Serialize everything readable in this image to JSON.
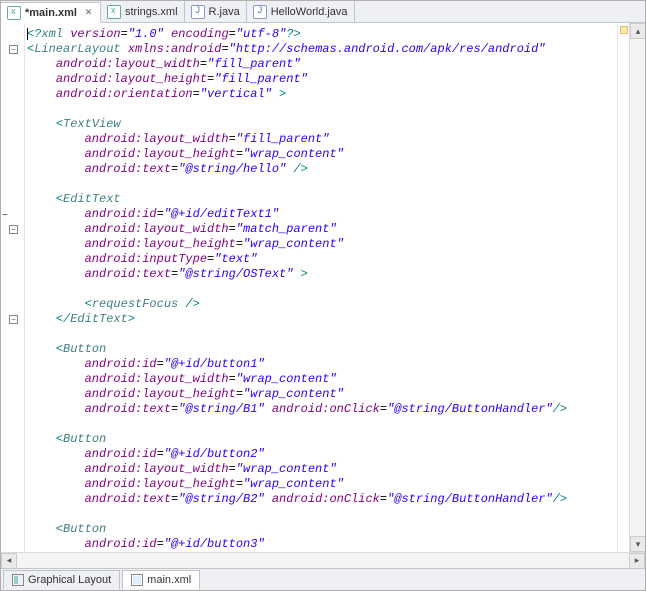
{
  "tabs": [
    {
      "label": "*main.xml",
      "icon": "xml",
      "active": true,
      "dirty": true,
      "closeable": true
    },
    {
      "label": "strings.xml",
      "icon": "xml",
      "active": false
    },
    {
      "label": "R.java",
      "icon": "java",
      "active": false
    },
    {
      "label": "HelloWorld.java",
      "icon": "java",
      "active": false
    }
  ],
  "bottom_tabs": [
    {
      "label": "Graphical Layout",
      "icon": "layout",
      "active": false
    },
    {
      "label": "main.xml",
      "icon": "file",
      "active": true
    }
  ],
  "fold_marks": [
    {
      "line": 1,
      "glyph": "−"
    },
    {
      "line": 14,
      "glyph": "−"
    },
    {
      "line": 20,
      "glyph": "−"
    }
  ],
  "collapse_bar": {
    "line": 13,
    "glyph": "−"
  },
  "code_lines": [
    {
      "cursor": true,
      "tokens": [
        {
          "t": "<?",
          "c": "punc"
        },
        {
          "t": "xml",
          "c": "tag"
        },
        {
          "t": " version",
          "c": "attr"
        },
        {
          "t": "=",
          "c": "plain"
        },
        {
          "t": "\"1.0\"",
          "c": "str"
        },
        {
          "t": " encoding",
          "c": "attr"
        },
        {
          "t": "=",
          "c": "plain"
        },
        {
          "t": "\"utf-8\"",
          "c": "str"
        },
        {
          "t": "?>",
          "c": "punc"
        }
      ]
    },
    {
      "indent": 0,
      "tokens": [
        {
          "t": "<",
          "c": "punc"
        },
        {
          "t": "LinearLayout",
          "c": "tag"
        },
        {
          "t": " xmlns:android",
          "c": "attr"
        },
        {
          "t": "=",
          "c": "plain"
        },
        {
          "t": "\"http://schemas.android.com/apk/res/android\"",
          "c": "str"
        }
      ]
    },
    {
      "indent": 1,
      "tokens": [
        {
          "t": "android:layout_width",
          "c": "attr"
        },
        {
          "t": "=",
          "c": "plain"
        },
        {
          "t": "\"fill_parent\"",
          "c": "str"
        }
      ]
    },
    {
      "indent": 1,
      "tokens": [
        {
          "t": "android:layout_height",
          "c": "attr"
        },
        {
          "t": "=",
          "c": "plain"
        },
        {
          "t": "\"fill_parent\"",
          "c": "str"
        }
      ]
    },
    {
      "indent": 1,
      "tokens": [
        {
          "t": "android:orientation",
          "c": "attr"
        },
        {
          "t": "=",
          "c": "plain"
        },
        {
          "t": "\"vertical\"",
          "c": "str"
        },
        {
          "t": " >",
          "c": "punc"
        }
      ]
    },
    {
      "blank": true
    },
    {
      "indent": 1,
      "tokens": [
        {
          "t": "<",
          "c": "punc"
        },
        {
          "t": "TextView",
          "c": "tag"
        }
      ]
    },
    {
      "indent": 2,
      "tokens": [
        {
          "t": "android:layout_width",
          "c": "attr"
        },
        {
          "t": "=",
          "c": "plain"
        },
        {
          "t": "\"fill_parent\"",
          "c": "str"
        }
      ]
    },
    {
      "indent": 2,
      "tokens": [
        {
          "t": "android:layout_height",
          "c": "attr"
        },
        {
          "t": "=",
          "c": "plain"
        },
        {
          "t": "\"wrap_content\"",
          "c": "str"
        }
      ]
    },
    {
      "indent": 2,
      "tokens": [
        {
          "t": "android:text",
          "c": "attr"
        },
        {
          "t": "=",
          "c": "plain"
        },
        {
          "t": "\"@string/hello\"",
          "c": "str"
        },
        {
          "t": " />",
          "c": "punc"
        }
      ]
    },
    {
      "blank": true
    },
    {
      "indent": 1,
      "tokens": [
        {
          "t": "<",
          "c": "punc"
        },
        {
          "t": "EditText",
          "c": "tag"
        }
      ]
    },
    {
      "indent": 2,
      "tokens": [
        {
          "t": "android:id",
          "c": "attr"
        },
        {
          "t": "=",
          "c": "plain"
        },
        {
          "t": "\"@+id/editText1\"",
          "c": "str"
        }
      ]
    },
    {
      "indent": 2,
      "tokens": [
        {
          "t": "android:layout_width",
          "c": "attr"
        },
        {
          "t": "=",
          "c": "plain"
        },
        {
          "t": "\"match_parent\"",
          "c": "str"
        }
      ]
    },
    {
      "indent": 2,
      "tokens": [
        {
          "t": "android:layout_height",
          "c": "attr"
        },
        {
          "t": "=",
          "c": "plain"
        },
        {
          "t": "\"wrap_content\"",
          "c": "str"
        }
      ]
    },
    {
      "indent": 2,
      "tokens": [
        {
          "t": "android:inputType",
          "c": "attr"
        },
        {
          "t": "=",
          "c": "plain"
        },
        {
          "t": "\"text\"",
          "c": "str"
        }
      ]
    },
    {
      "indent": 2,
      "tokens": [
        {
          "t": "android:text",
          "c": "attr"
        },
        {
          "t": "=",
          "c": "plain"
        },
        {
          "t": "\"@string/OSText\"",
          "c": "str"
        },
        {
          "t": " >",
          "c": "punc"
        }
      ]
    },
    {
      "blank": true
    },
    {
      "indent": 2,
      "tokens": [
        {
          "t": "<",
          "c": "punc"
        },
        {
          "t": "requestFocus",
          "c": "tag"
        },
        {
          "t": " />",
          "c": "punc"
        }
      ]
    },
    {
      "indent": 1,
      "tokens": [
        {
          "t": "</",
          "c": "punc"
        },
        {
          "t": "EditText",
          "c": "tag"
        },
        {
          "t": ">",
          "c": "punc"
        }
      ]
    },
    {
      "blank": true
    },
    {
      "indent": 1,
      "tokens": [
        {
          "t": "<",
          "c": "punc"
        },
        {
          "t": "Button",
          "c": "tag"
        }
      ]
    },
    {
      "indent": 2,
      "tokens": [
        {
          "t": "android:id",
          "c": "attr"
        },
        {
          "t": "=",
          "c": "plain"
        },
        {
          "t": "\"@+id/button1\"",
          "c": "str"
        }
      ]
    },
    {
      "indent": 2,
      "tokens": [
        {
          "t": "android:layout_width",
          "c": "attr"
        },
        {
          "t": "=",
          "c": "plain"
        },
        {
          "t": "\"wrap_content\"",
          "c": "str"
        }
      ]
    },
    {
      "indent": 2,
      "tokens": [
        {
          "t": "android:layout_height",
          "c": "attr"
        },
        {
          "t": "=",
          "c": "plain"
        },
        {
          "t": "\"wrap_content\"",
          "c": "str"
        }
      ]
    },
    {
      "indent": 2,
      "tokens": [
        {
          "t": "android:text",
          "c": "attr"
        },
        {
          "t": "=",
          "c": "plain"
        },
        {
          "t": "\"@string/B1\"",
          "c": "str"
        },
        {
          "t": " android:onClick",
          "c": "attr"
        },
        {
          "t": "=",
          "c": "plain"
        },
        {
          "t": "\"@string/ButtonHandler\"",
          "c": "str"
        },
        {
          "t": "/>",
          "c": "punc"
        }
      ]
    },
    {
      "blank": true
    },
    {
      "indent": 1,
      "tokens": [
        {
          "t": "<",
          "c": "punc"
        },
        {
          "t": "Button",
          "c": "tag"
        }
      ]
    },
    {
      "indent": 2,
      "tokens": [
        {
          "t": "android:id",
          "c": "attr"
        },
        {
          "t": "=",
          "c": "plain"
        },
        {
          "t": "\"@+id/button2\"",
          "c": "str"
        }
      ]
    },
    {
      "indent": 2,
      "tokens": [
        {
          "t": "android:layout_width",
          "c": "attr"
        },
        {
          "t": "=",
          "c": "plain"
        },
        {
          "t": "\"wrap_content\"",
          "c": "str"
        }
      ]
    },
    {
      "indent": 2,
      "tokens": [
        {
          "t": "android:layout_height",
          "c": "attr"
        },
        {
          "t": "=",
          "c": "plain"
        },
        {
          "t": "\"wrap_content\"",
          "c": "str"
        }
      ]
    },
    {
      "indent": 2,
      "tokens": [
        {
          "t": "android:text",
          "c": "attr"
        },
        {
          "t": "=",
          "c": "plain"
        },
        {
          "t": "\"@string/B2\"",
          "c": "str"
        },
        {
          "t": " android:onClick",
          "c": "attr"
        },
        {
          "t": "=",
          "c": "plain"
        },
        {
          "t": "\"@string/ButtonHandler\"",
          "c": "str"
        },
        {
          "t": "/>",
          "c": "punc"
        }
      ]
    },
    {
      "blank": true
    },
    {
      "indent": 1,
      "tokens": [
        {
          "t": "<",
          "c": "punc"
        },
        {
          "t": "Button",
          "c": "tag"
        }
      ]
    },
    {
      "indent": 2,
      "tokens": [
        {
          "t": "android:id",
          "c": "attr"
        },
        {
          "t": "=",
          "c": "plain"
        },
        {
          "t": "\"@+id/button3\"",
          "c": "str"
        }
      ]
    }
  ]
}
